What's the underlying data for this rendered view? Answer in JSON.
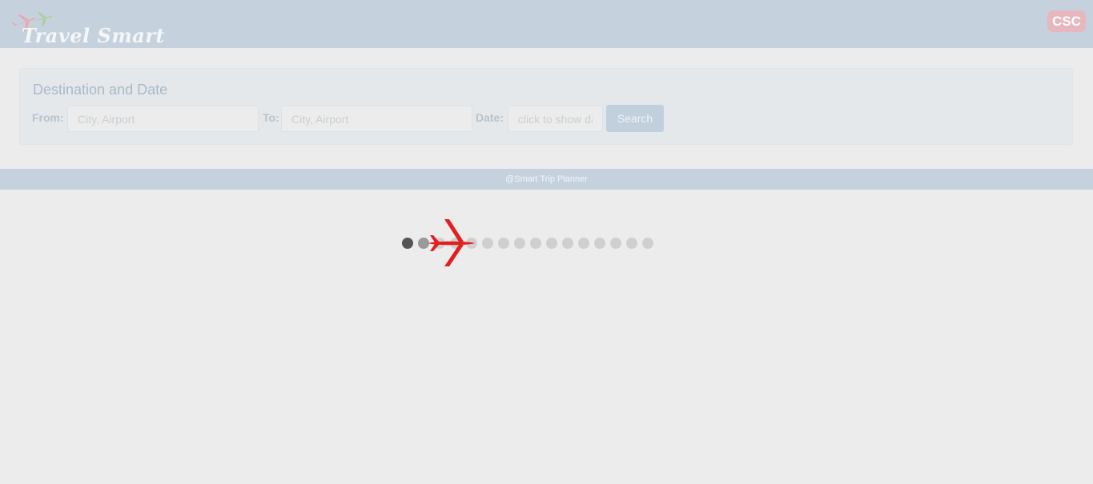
{
  "header": {
    "logo_text": "Travel Smart",
    "badge": "CSC"
  },
  "search_panel": {
    "title": "Destination and Date",
    "from_label": "From:",
    "from_placeholder": "City, Airport",
    "to_label": "To:",
    "to_placeholder": "City, Airport",
    "date_label": "Date:",
    "date_placeholder": "click to show date",
    "search_label": "Search"
  },
  "footer": {
    "text": "@Smart Trip Planner"
  },
  "loader": {
    "dot_count": 16,
    "plane_icon": "airplane-icon",
    "colors": {
      "plane": "#e0201f",
      "dot_active": "#555555",
      "dot_partial": "#9a9a9a",
      "dot_idle": "#cfcfcf"
    }
  }
}
